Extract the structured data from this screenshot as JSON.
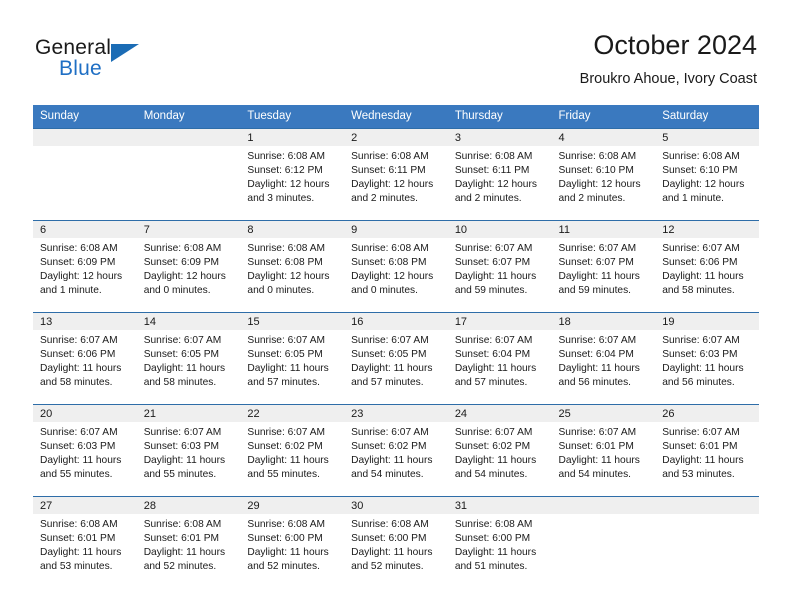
{
  "brand": {
    "word1": "General",
    "word2": "Blue",
    "flag_icon": "triangle-flag-icon",
    "accent_color": "#1b6cb5"
  },
  "header": {
    "title": "October 2024",
    "subtitle": "Broukro Ahoue, Ivory Coast"
  },
  "theme": {
    "header_row_bg": "#3A79BF",
    "week_border": "#2E6DA8",
    "daynum_band_bg": "#EFEFEF"
  },
  "weekday_headers": [
    "Sunday",
    "Monday",
    "Tuesday",
    "Wednesday",
    "Thursday",
    "Friday",
    "Saturday"
  ],
  "weeks": [
    [
      {
        "day": "",
        "empty": true
      },
      {
        "day": "",
        "empty": true
      },
      {
        "day": "1",
        "sunrise": "Sunrise: 6:08 AM",
        "sunset": "Sunset: 6:12 PM",
        "daylight_1": "Daylight: 12 hours",
        "daylight_2": "and 3 minutes."
      },
      {
        "day": "2",
        "sunrise": "Sunrise: 6:08 AM",
        "sunset": "Sunset: 6:11 PM",
        "daylight_1": "Daylight: 12 hours",
        "daylight_2": "and 2 minutes."
      },
      {
        "day": "3",
        "sunrise": "Sunrise: 6:08 AM",
        "sunset": "Sunset: 6:11 PM",
        "daylight_1": "Daylight: 12 hours",
        "daylight_2": "and 2 minutes."
      },
      {
        "day": "4",
        "sunrise": "Sunrise: 6:08 AM",
        "sunset": "Sunset: 6:10 PM",
        "daylight_1": "Daylight: 12 hours",
        "daylight_2": "and 2 minutes."
      },
      {
        "day": "5",
        "sunrise": "Sunrise: 6:08 AM",
        "sunset": "Sunset: 6:10 PM",
        "daylight_1": "Daylight: 12 hours",
        "daylight_2": "and 1 minute."
      }
    ],
    [
      {
        "day": "6",
        "sunrise": "Sunrise: 6:08 AM",
        "sunset": "Sunset: 6:09 PM",
        "daylight_1": "Daylight: 12 hours",
        "daylight_2": "and 1 minute."
      },
      {
        "day": "7",
        "sunrise": "Sunrise: 6:08 AM",
        "sunset": "Sunset: 6:09 PM",
        "daylight_1": "Daylight: 12 hours",
        "daylight_2": "and 0 minutes."
      },
      {
        "day": "8",
        "sunrise": "Sunrise: 6:08 AM",
        "sunset": "Sunset: 6:08 PM",
        "daylight_1": "Daylight: 12 hours",
        "daylight_2": "and 0 minutes."
      },
      {
        "day": "9",
        "sunrise": "Sunrise: 6:08 AM",
        "sunset": "Sunset: 6:08 PM",
        "daylight_1": "Daylight: 12 hours",
        "daylight_2": "and 0 minutes."
      },
      {
        "day": "10",
        "sunrise": "Sunrise: 6:07 AM",
        "sunset": "Sunset: 6:07 PM",
        "daylight_1": "Daylight: 11 hours",
        "daylight_2": "and 59 minutes."
      },
      {
        "day": "11",
        "sunrise": "Sunrise: 6:07 AM",
        "sunset": "Sunset: 6:07 PM",
        "daylight_1": "Daylight: 11 hours",
        "daylight_2": "and 59 minutes."
      },
      {
        "day": "12",
        "sunrise": "Sunrise: 6:07 AM",
        "sunset": "Sunset: 6:06 PM",
        "daylight_1": "Daylight: 11 hours",
        "daylight_2": "and 58 minutes."
      }
    ],
    [
      {
        "day": "13",
        "sunrise": "Sunrise: 6:07 AM",
        "sunset": "Sunset: 6:06 PM",
        "daylight_1": "Daylight: 11 hours",
        "daylight_2": "and 58 minutes."
      },
      {
        "day": "14",
        "sunrise": "Sunrise: 6:07 AM",
        "sunset": "Sunset: 6:05 PM",
        "daylight_1": "Daylight: 11 hours",
        "daylight_2": "and 58 minutes."
      },
      {
        "day": "15",
        "sunrise": "Sunrise: 6:07 AM",
        "sunset": "Sunset: 6:05 PM",
        "daylight_1": "Daylight: 11 hours",
        "daylight_2": "and 57 minutes."
      },
      {
        "day": "16",
        "sunrise": "Sunrise: 6:07 AM",
        "sunset": "Sunset: 6:05 PM",
        "daylight_1": "Daylight: 11 hours",
        "daylight_2": "and 57 minutes."
      },
      {
        "day": "17",
        "sunrise": "Sunrise: 6:07 AM",
        "sunset": "Sunset: 6:04 PM",
        "daylight_1": "Daylight: 11 hours",
        "daylight_2": "and 57 minutes."
      },
      {
        "day": "18",
        "sunrise": "Sunrise: 6:07 AM",
        "sunset": "Sunset: 6:04 PM",
        "daylight_1": "Daylight: 11 hours",
        "daylight_2": "and 56 minutes."
      },
      {
        "day": "19",
        "sunrise": "Sunrise: 6:07 AM",
        "sunset": "Sunset: 6:03 PM",
        "daylight_1": "Daylight: 11 hours",
        "daylight_2": "and 56 minutes."
      }
    ],
    [
      {
        "day": "20",
        "sunrise": "Sunrise: 6:07 AM",
        "sunset": "Sunset: 6:03 PM",
        "daylight_1": "Daylight: 11 hours",
        "daylight_2": "and 55 minutes."
      },
      {
        "day": "21",
        "sunrise": "Sunrise: 6:07 AM",
        "sunset": "Sunset: 6:03 PM",
        "daylight_1": "Daylight: 11 hours",
        "daylight_2": "and 55 minutes."
      },
      {
        "day": "22",
        "sunrise": "Sunrise: 6:07 AM",
        "sunset": "Sunset: 6:02 PM",
        "daylight_1": "Daylight: 11 hours",
        "daylight_2": "and 55 minutes."
      },
      {
        "day": "23",
        "sunrise": "Sunrise: 6:07 AM",
        "sunset": "Sunset: 6:02 PM",
        "daylight_1": "Daylight: 11 hours",
        "daylight_2": "and 54 minutes."
      },
      {
        "day": "24",
        "sunrise": "Sunrise: 6:07 AM",
        "sunset": "Sunset: 6:02 PM",
        "daylight_1": "Daylight: 11 hours",
        "daylight_2": "and 54 minutes."
      },
      {
        "day": "25",
        "sunrise": "Sunrise: 6:07 AM",
        "sunset": "Sunset: 6:01 PM",
        "daylight_1": "Daylight: 11 hours",
        "daylight_2": "and 54 minutes."
      },
      {
        "day": "26",
        "sunrise": "Sunrise: 6:07 AM",
        "sunset": "Sunset: 6:01 PM",
        "daylight_1": "Daylight: 11 hours",
        "daylight_2": "and 53 minutes."
      }
    ],
    [
      {
        "day": "27",
        "sunrise": "Sunrise: 6:08 AM",
        "sunset": "Sunset: 6:01 PM",
        "daylight_1": "Daylight: 11 hours",
        "daylight_2": "and 53 minutes."
      },
      {
        "day": "28",
        "sunrise": "Sunrise: 6:08 AM",
        "sunset": "Sunset: 6:01 PM",
        "daylight_1": "Daylight: 11 hours",
        "daylight_2": "and 52 minutes."
      },
      {
        "day": "29",
        "sunrise": "Sunrise: 6:08 AM",
        "sunset": "Sunset: 6:00 PM",
        "daylight_1": "Daylight: 11 hours",
        "daylight_2": "and 52 minutes."
      },
      {
        "day": "30",
        "sunrise": "Sunrise: 6:08 AM",
        "sunset": "Sunset: 6:00 PM",
        "daylight_1": "Daylight: 11 hours",
        "daylight_2": "and 52 minutes."
      },
      {
        "day": "31",
        "sunrise": "Sunrise: 6:08 AM",
        "sunset": "Sunset: 6:00 PM",
        "daylight_1": "Daylight: 11 hours",
        "daylight_2": "and 51 minutes."
      },
      {
        "day": "",
        "empty": true
      },
      {
        "day": "",
        "empty": true
      }
    ]
  ]
}
